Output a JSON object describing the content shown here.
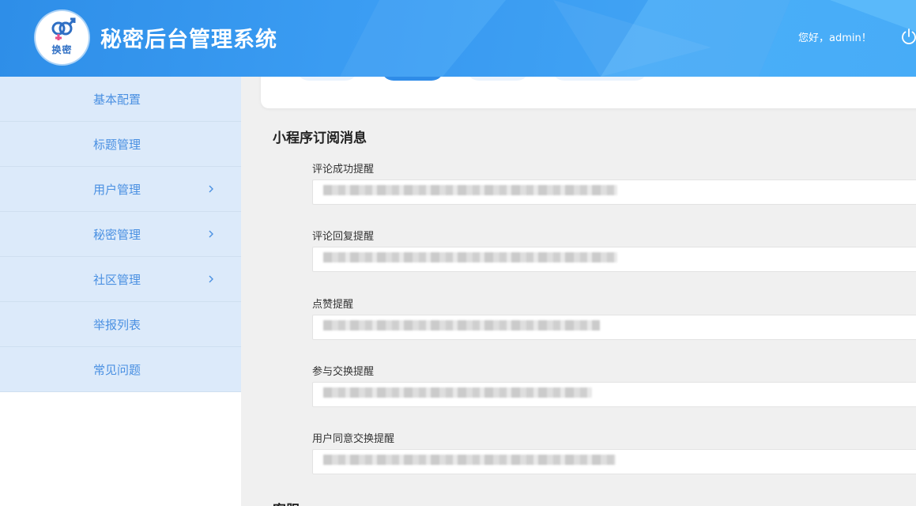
{
  "header": {
    "logo_text": "换密",
    "title": "秘密后台管理系统",
    "greeting": "您好，admin！",
    "colors": {
      "gradient_start": "#2e8ee8",
      "gradient_end": "#44a9f7"
    }
  },
  "sidebar": {
    "items": [
      {
        "label": "基本配置",
        "has_submenu": false
      },
      {
        "label": "标题管理",
        "has_submenu": false
      },
      {
        "label": "用户管理",
        "has_submenu": true
      },
      {
        "label": "秘密管理",
        "has_submenu": true
      },
      {
        "label": "社区管理",
        "has_submenu": true
      },
      {
        "label": "举报列表",
        "has_submenu": false
      },
      {
        "label": "常见问题",
        "has_submenu": false
      }
    ],
    "colors": {
      "background": "#dceafa",
      "text": "#4a90e2"
    }
  },
  "main": {
    "section_title": "小程序订阅消息",
    "fields": [
      {
        "label": "评论成功提醒",
        "value": ""
      },
      {
        "label": "评论回复提醒",
        "value": ""
      },
      {
        "label": "点赞提醒",
        "value": ""
      },
      {
        "label": "参与交换提醒",
        "value": ""
      },
      {
        "label": "用户同意交换提醒",
        "value": ""
      }
    ],
    "next_section_title": "客服"
  },
  "icons": {
    "logo": "gender-symbol-icon",
    "power": "power-icon",
    "chevron": "chevron-right-icon"
  }
}
